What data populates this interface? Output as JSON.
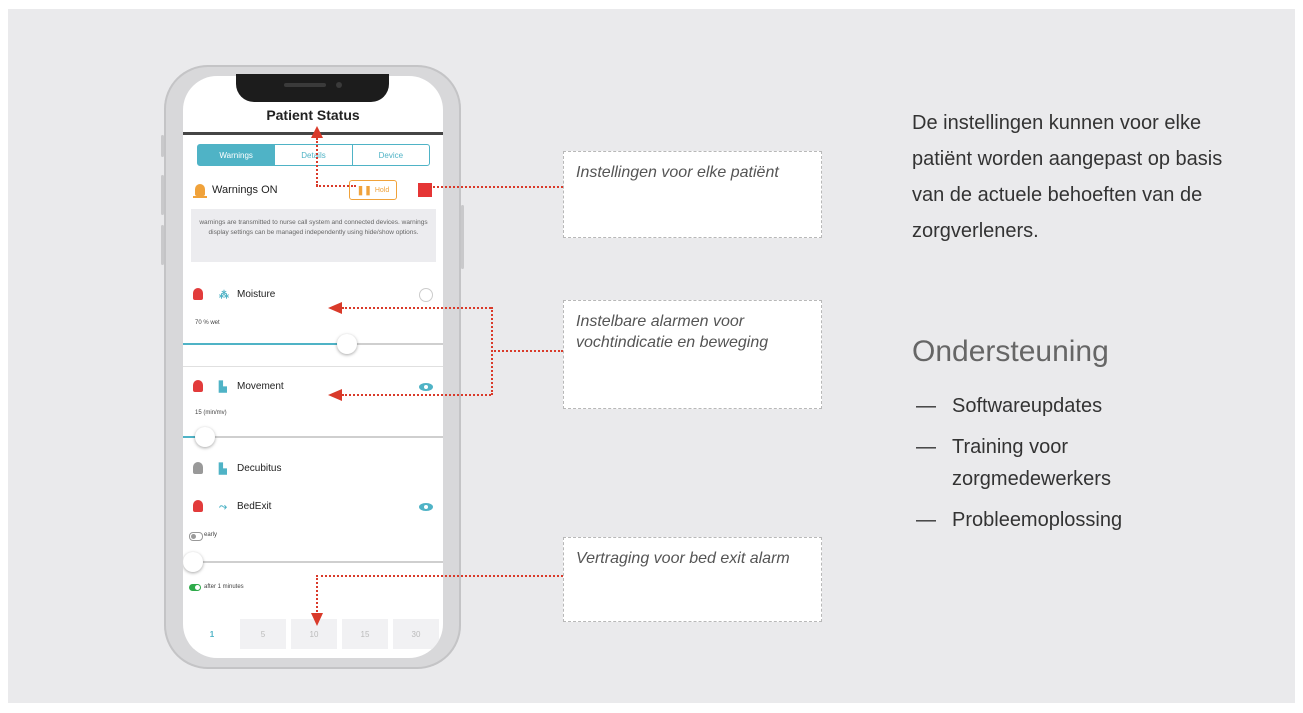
{
  "phone": {
    "title": "Patient Status",
    "tabs": [
      {
        "label": "Warnings",
        "active": true
      },
      {
        "label": "Details",
        "active": false
      },
      {
        "label": "Device",
        "active": false
      }
    ],
    "warnings_label": "Warnings ON",
    "hold_label": "Hold",
    "info_text": "warnings are transmitted to nurse call system and connected devices. warnings display settings can be managed independently using hide/show options.",
    "moisture": {
      "label": "Moisture",
      "value": "70 % wet",
      "level_fraction": 0.64
    },
    "movement": {
      "label": "Movement",
      "value": "15 (min/mv)",
      "level_fraction": 0.05
    },
    "decubitus": {
      "label": "Decubitus"
    },
    "bedexit": {
      "label": "BedExit",
      "toggle_label": "early",
      "toggle2_label": "after 1 minutes",
      "level_fraction": 0.0
    },
    "delays": [
      "1",
      "5",
      "10",
      "15",
      "30"
    ],
    "selected_delay": "1"
  },
  "callouts": {
    "settings": "Instellingen voor elke patiënt",
    "alarms": "Instelbare alarmen voor vochtindicatie en beweging",
    "delay": "Vertraging voor bed exit alarm"
  },
  "right": {
    "description": "De instellingen kunnen voor elke patiënt worden aangepast op basis van de actuele behoeften van de zorgverleners.",
    "heading": "Ondersteuning",
    "items": [
      "Softwareupdates",
      "Training voor zorgmedewerkers",
      "Probleemoplossing"
    ]
  },
  "colors": {
    "accent": "#4fb3c6",
    "alarm": "#e23b3b",
    "warning": "#f0a23a",
    "pointer": "#d93a2a",
    "panel": "#eaeaec"
  }
}
